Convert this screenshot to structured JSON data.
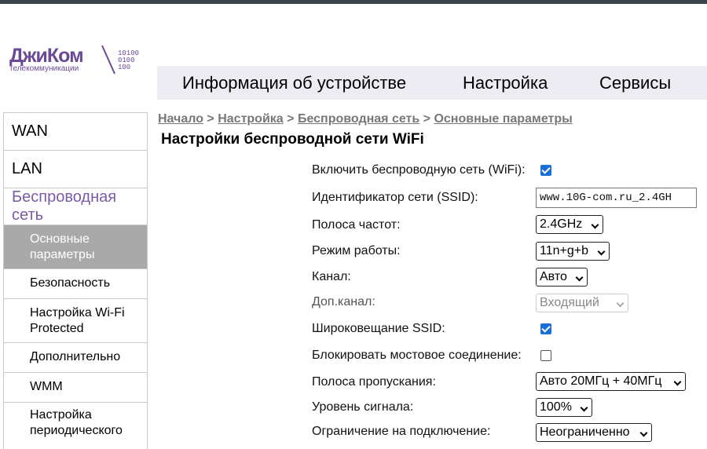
{
  "logo": {
    "name": "ДжиКом",
    "subtitle": "телекоммуникации",
    "bits": "10100\n0100\n100",
    "color": "#6a4a96"
  },
  "nav": {
    "items": [
      "Информация об устройстве",
      "Настройка",
      "Сервисы"
    ]
  },
  "sidebar": {
    "items": {
      "wan": "WAN",
      "lan": "LAN",
      "wireless_group": "Беспроводная сеть",
      "basic": "Основные параметры",
      "security": "Безопасность",
      "wps": "Настройка Wi-Fi Protected",
      "advanced": "Дополнительно",
      "wmm": "WMM",
      "periodic": "Настройка периодического"
    }
  },
  "breadcrumb": {
    "items": [
      "Начало",
      "Настройка",
      "Беспроводная сеть",
      "Основные параметры"
    ],
    "separator": ">"
  },
  "page": {
    "title": "Настройки беспроводной сети WiFi"
  },
  "form": {
    "enable_wifi": {
      "label": "Включить беспроводную сеть (WiFi):",
      "checked": true
    },
    "ssid": {
      "label": "Идентификатор сети (SSID):",
      "value": "www.10G-com.ru_2.4GH"
    },
    "band": {
      "label": "Полоса частот:",
      "value": "2.4GHz"
    },
    "mode": {
      "label": "Режим работы:",
      "value": "11n+g+b"
    },
    "channel": {
      "label": "Канал:",
      "value": "Авто"
    },
    "ext_channel": {
      "label": "Доп.канал:",
      "value": "Входящий"
    },
    "broadcast_ssid": {
      "label": "Широковещание SSID:",
      "checked": true
    },
    "block_bridge": {
      "label": "Блокировать мостовое соединение:",
      "checked": false
    },
    "bandwidth": {
      "label": "Полоса пропускания:",
      "value": "Авто 20МГц + 40МГц"
    },
    "signal_level": {
      "label": "Уровень сигнала:",
      "value": "100%"
    },
    "conn_limit": {
      "label": "Ограничение на подключение:",
      "value": "Неограниченно"
    }
  },
  "colors": {
    "accent": "#1a6fd6",
    "brand": "#6a4a96",
    "nav_bg": "#eeecf3",
    "sidebar_active": "#a9a9a9"
  }
}
